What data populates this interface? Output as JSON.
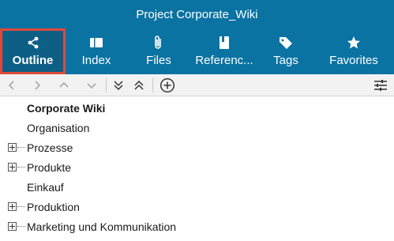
{
  "window": {
    "title": "Project Corporate_Wiki"
  },
  "tabs": [
    {
      "label": "Outline",
      "icon": "share-icon",
      "active": true
    },
    {
      "label": "Index",
      "icon": "index-icon"
    },
    {
      "label": "Files",
      "icon": "paperclip-icon"
    },
    {
      "label": "Referenc...",
      "icon": "book-icon"
    },
    {
      "label": "Tags",
      "icon": "tag-icon"
    },
    {
      "label": "Favorites",
      "icon": "star-icon"
    }
  ],
  "toolbar": {
    "buttons": [
      "back-icon",
      "forward-icon",
      "up-icon",
      "down-icon",
      "expand-all-icon",
      "collapse-all-icon",
      "add-icon",
      "settings-icon"
    ]
  },
  "colors": {
    "header": "#0b73a2",
    "active_tab": "#0e5f86",
    "highlight": "#e0493a"
  },
  "tree": [
    {
      "label": "Corporate Wiki",
      "bold": true,
      "expandable": false
    },
    {
      "label": "Organisation",
      "expandable": false
    },
    {
      "label": "Prozesse",
      "expandable": true
    },
    {
      "label": "Produkte",
      "expandable": true
    },
    {
      "label": "Einkauf",
      "expandable": false
    },
    {
      "label": "Produktion",
      "expandable": true
    },
    {
      "label": "Marketing und Kommunikation",
      "expandable": true
    }
  ]
}
